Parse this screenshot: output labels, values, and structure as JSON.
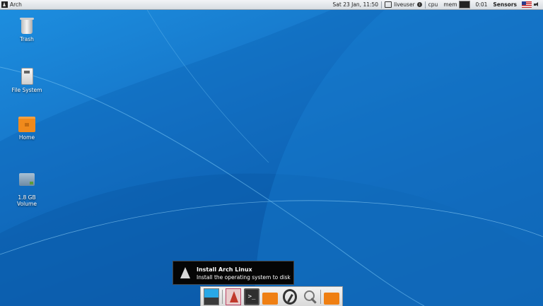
{
  "panel": {
    "menu_label": "Arch",
    "datetime": "Sat 23 Jan, 11:50",
    "user": "liveuser",
    "info": "i",
    "cpu_label": "cpu",
    "mem_label": "mem",
    "uptime": "0:01",
    "sensors_label": "Sensors"
  },
  "desktop": {
    "icons": [
      {
        "label": "Trash"
      },
      {
        "label": "File System"
      },
      {
        "label": "Home"
      },
      {
        "label": "1.8 GB\nVolume"
      }
    ]
  },
  "tooltip": {
    "title": "Install Arch Linux",
    "description": "Install the operating system to disk"
  },
  "dock": {
    "terminal_glyph": ">_"
  }
}
